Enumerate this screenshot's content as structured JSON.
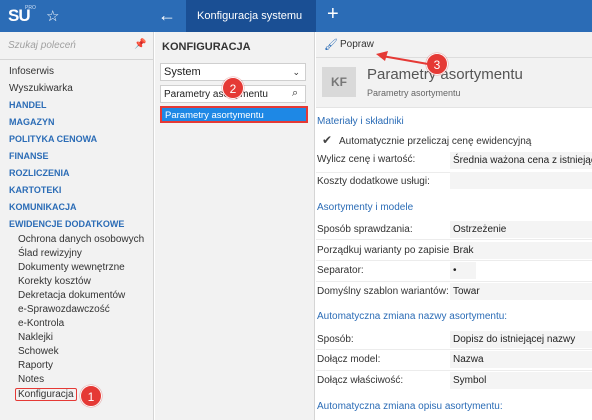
{
  "topbar": {
    "logo": "SU",
    "logo_sup": "PRO",
    "star_icon": "★",
    "back_icon": "←",
    "tab_title": "Konfiguracja systemu",
    "plus_icon": "+"
  },
  "sidebar": {
    "search_placeholder": "Szukaj poleceń",
    "pin_icon": "📌",
    "items": [
      "Infoserwis",
      "Wyszukiwarka"
    ],
    "groups": [
      "HANDEL",
      "MAGAZYN",
      "POLITYKA CENOWA",
      "FINANSE",
      "ROZLICZENIA",
      "KARTOTEKI",
      "KOMUNIKACJA",
      "EWIDENCJE DODATKOWE"
    ],
    "sub_items": [
      "Ochrona danych osobowych",
      "Ślad rewizyjny",
      "Dokumenty wewnętrzne",
      "Korekty kosztów",
      "Dekretacja dokumentów",
      "e-Sprawozdawczość",
      "e-Kontrola",
      "Naklejki",
      "Schowek",
      "Raporty",
      "Notes",
      "Konfiguracja"
    ]
  },
  "middle": {
    "title": "KONFIGURACJA",
    "select_value": "System",
    "search_value": "Parametry asortymentu",
    "result": "Parametry asortymentu"
  },
  "right": {
    "toolbar_label": "Popraw",
    "header_badge": "KF",
    "header_title": "Parametry asortymentu",
    "header_subtitle": "Parametry asortymentu",
    "sections": {
      "materials": "Materiały i składniki",
      "assortments": "Asortymenty i modele",
      "name_change": "Automatyczna zmiana nazwy asortymentu:",
      "desc_change": "Automatyczna zmiana opisu asortymentu:"
    },
    "checkbox_label": "Automatycznie przeliczaj cenę ewidencyjną",
    "fields": [
      {
        "label": "Wylicz cenę i wartość:",
        "value": "Średnia ważona cena z istniejących"
      },
      {
        "label": "Koszty dodatkowe usługi:",
        "value": ""
      },
      {
        "label": "Sposób sprawdzania:",
        "value": "Ostrzeżenie"
      },
      {
        "label": "Porządkuj warianty po zapisie:",
        "value": "Brak"
      },
      {
        "label": "Separator:",
        "value": "•"
      },
      {
        "label": "Domyślny szablon wariantów:",
        "value": "Towar"
      },
      {
        "label": "Sposób:",
        "value": "Dopisz do istniejącej nazwy"
      },
      {
        "label": "Dołącz model:",
        "value": "Nazwa"
      },
      {
        "label": "Dołącz właściwość:",
        "value": "Symbol"
      }
    ]
  },
  "callouts": [
    "1",
    "2",
    "3"
  ],
  "colors": {
    "accent": "#2b6cb6",
    "highlight": "#e53935",
    "selection": "#1e88e5"
  }
}
